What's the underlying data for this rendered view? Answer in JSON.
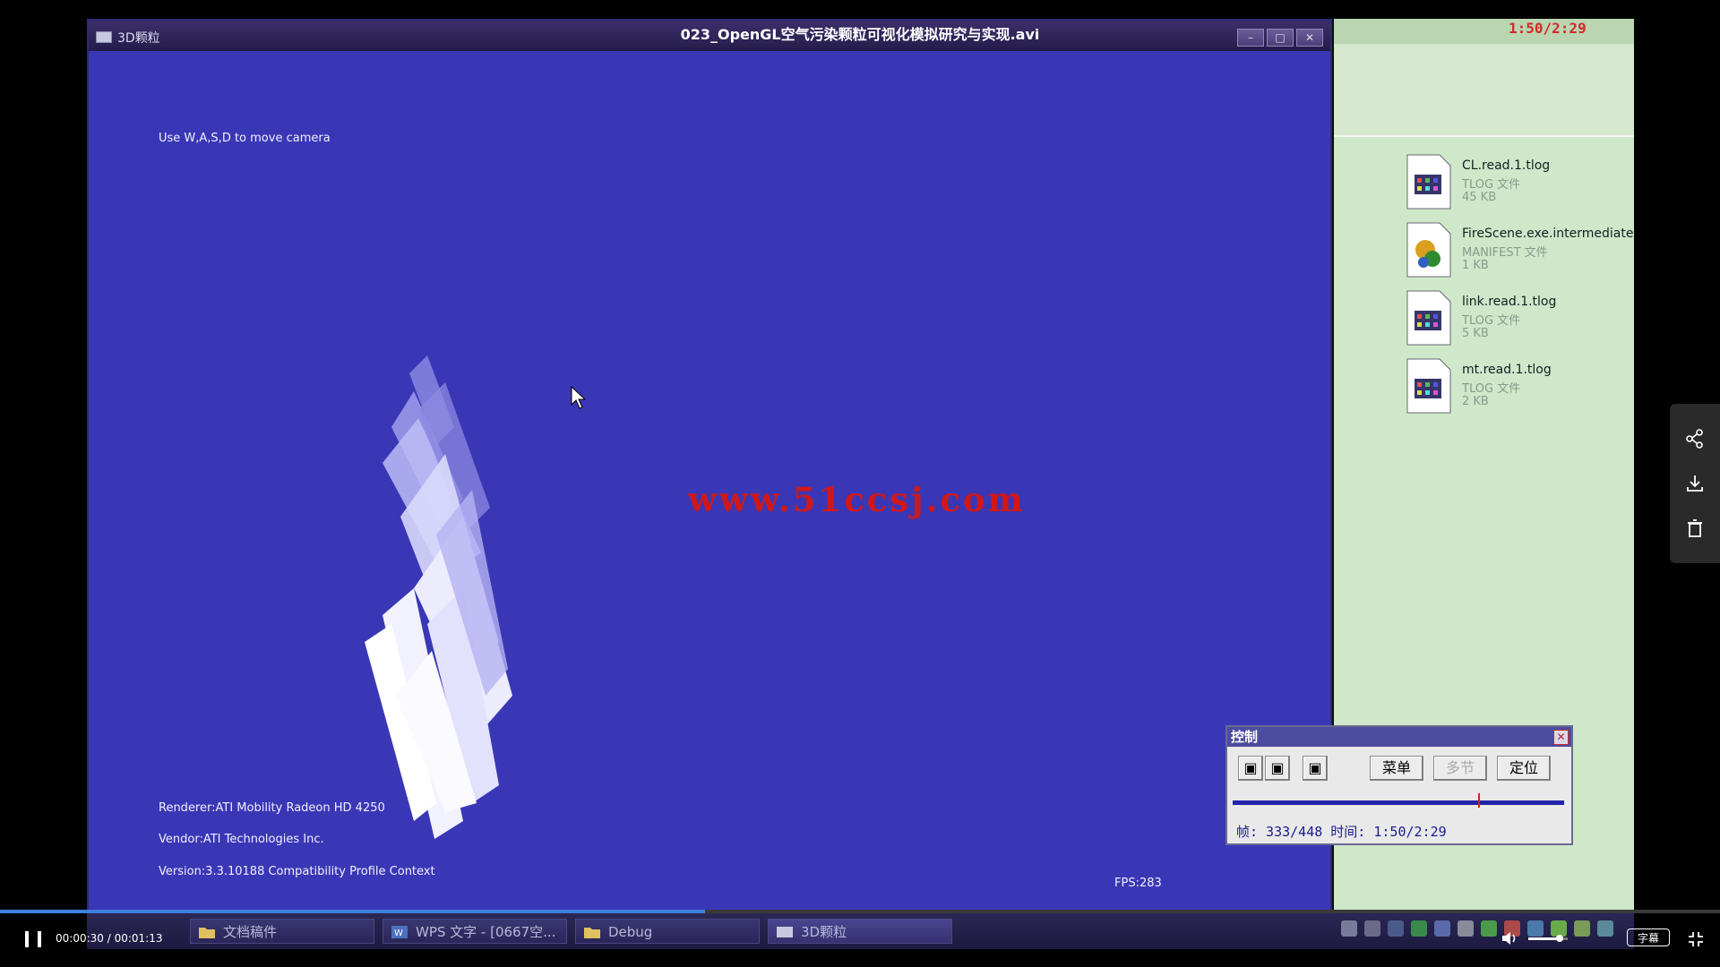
{
  "video_title": "023_OpenGL空气污染颗粒可视化模拟研究与实现.avi",
  "xp_window": {
    "title": "3D颗粒",
    "help_text": "Use W,A,S,D to move camera",
    "renderer": "Renderer:ATI Mobility Radeon HD 4250",
    "vendor": "Vendor:ATI Technologies Inc.",
    "version": "Version:3.3.10188 Compatibility Profile Context",
    "fps": "FPS:283",
    "watermark": "www.51ccsj.com",
    "bg_color": "#3a37b6"
  },
  "explorer": {
    "timer": "1:50/2:29",
    "files": [
      {
        "name": "CL.read.1.tlog",
        "type": "TLOG 文件",
        "size": "45 KB",
        "icon": "tlog-file-icon"
      },
      {
        "name": "FireScene.exe.intermediate.m",
        "type": "MANIFEST 文件",
        "size": "1 KB",
        "icon": "manifest-file-icon"
      },
      {
        "name": "link.read.1.tlog",
        "type": "TLOG 文件",
        "size": "5 KB",
        "icon": "tlog-file-icon"
      },
      {
        "name": "mt.read.1.tlog",
        "type": "TLOG 文件",
        "size": "2 KB",
        "icon": "tlog-file-icon"
      }
    ]
  },
  "control_panel": {
    "title": "控制",
    "close": "✕",
    "buttons": {
      "menu": "菜单",
      "multi": "多节",
      "locate": "定位"
    },
    "info": "帧: 333/448 时间: 1:50/2:29",
    "progress": 0.74
  },
  "xp_taskbar": {
    "items": [
      "文档稿件",
      "WPS 文字 - [0667空...",
      "Debug",
      "3D颗粒"
    ]
  },
  "player": {
    "timecode": "00:00:30 / 00:01:13",
    "progress": 0.41,
    "volume": 0.8,
    "subtitle_label": "字幕"
  }
}
